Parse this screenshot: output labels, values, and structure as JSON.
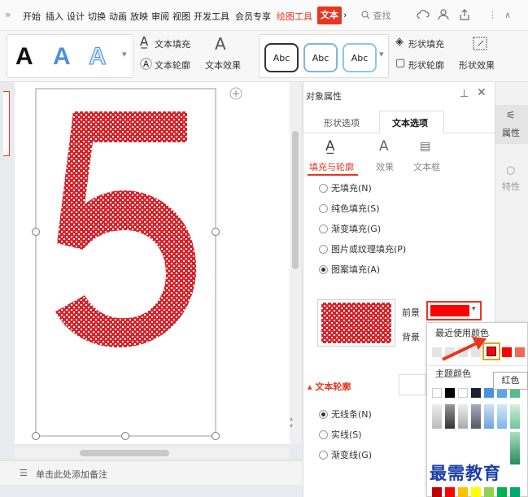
{
  "menubar": {
    "chevron": "»",
    "items": [
      "开始",
      "插入",
      "设计",
      "切换",
      "动画",
      "放映",
      "审阅",
      "视图",
      "开发工具",
      "会员专享",
      "绘图工具"
    ],
    "active_tab": "文本",
    "active_tab_arrow": "›",
    "search": "查找",
    "more": "⋮",
    "collapse": "∧"
  },
  "ribbon": {
    "styles": [
      "A",
      "A",
      "A"
    ],
    "text_fill": "文本填充",
    "text_outline": "文本轮廓",
    "text_effect": "文本效果",
    "abc_samples": [
      "Abc",
      "Abc",
      "Abc"
    ],
    "shape_fill": "形状填充",
    "shape_outline": "形状轮廓",
    "shape_effect": "形状效果"
  },
  "slide": {
    "big_text": "5",
    "note_placeholder": "单击此处添加备注"
  },
  "panel": {
    "title": "对象属性",
    "tabs": [
      "形状选项",
      "文本选项"
    ],
    "active_tab": 1,
    "subtabs": [
      "填充与轮廓",
      "效果",
      "文本框"
    ],
    "fill_options": [
      "无填充(N)",
      "纯色填充(S)",
      "渐变填充(G)",
      "图片或纹理填充(P)",
      "图案填充(A)"
    ],
    "fill_selected": 4,
    "foreground_label": "前景",
    "background_label": "背景",
    "outline_section": "文本轮廓",
    "outline_options": [
      "无线条(N)",
      "实线(S)",
      "渐变线(G)"
    ],
    "outline_selected": 0
  },
  "sidestrip": {
    "properties": "属性",
    "features": "特性"
  },
  "color_popup": {
    "recent_label": "最近使用颜色",
    "theme_label": "主题颜色",
    "tooltip": "红色",
    "foreground_color": "#ff0000"
  },
  "watermark": "最需教育",
  "colors": {
    "accent": "#e8361f",
    "pattern_red": "#d9232a"
  }
}
